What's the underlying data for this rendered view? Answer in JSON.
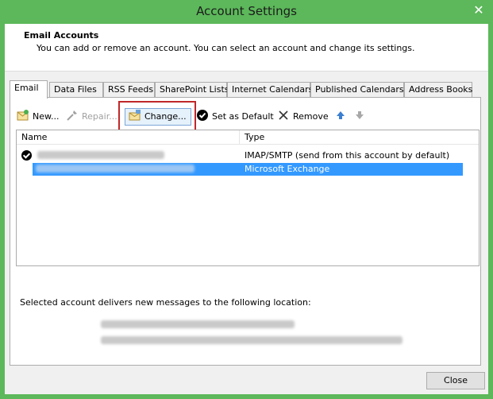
{
  "window": {
    "title": "Account Settings",
    "close_glyph": "✕"
  },
  "header": {
    "title": "Email Accounts",
    "description": "You can add or remove an account. You can select an account and change its settings."
  },
  "tabs": [
    {
      "label": "Email",
      "active": true
    },
    {
      "label": "Data Files"
    },
    {
      "label": "RSS Feeds"
    },
    {
      "label": "SharePoint Lists"
    },
    {
      "label": "Internet Calendars"
    },
    {
      "label": "Published Calendars"
    },
    {
      "label": "Address Books"
    }
  ],
  "toolbar": {
    "new_label": "New...",
    "repair_label": "Repair...",
    "change_label": "Change...",
    "set_default_label": "Set as Default",
    "remove_label": "Remove"
  },
  "list": {
    "headers": {
      "name": "Name",
      "type": "Type"
    },
    "rows": [
      {
        "type": "IMAP/SMTP (send from this account by default)",
        "default": true,
        "selected": false
      },
      {
        "type": "Microsoft Exchange",
        "default": false,
        "selected": true
      }
    ]
  },
  "delivery": {
    "label": "Selected account delivers new messages to the following location:"
  },
  "footer": {
    "close_label": "Close"
  },
  "colors": {
    "titlebar": "#5cb85a",
    "selection": "#3399ff",
    "highlight_box": "#c0282a"
  }
}
